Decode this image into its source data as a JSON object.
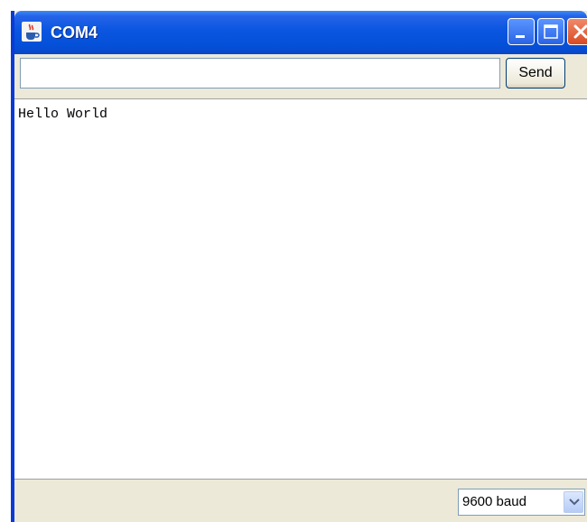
{
  "window": {
    "title": "COM4",
    "icon": "java-cup-icon",
    "controls": [
      "minimize-icon",
      "maximize-icon",
      "close-icon"
    ]
  },
  "input_bar": {
    "value": "",
    "placeholder": "",
    "send_label": "Send"
  },
  "output": {
    "text": "Hello World"
  },
  "status_bar": {
    "baud_rate": "9600 baud"
  },
  "colors": {
    "titlebar": "#0a56e0",
    "close_button": "#d84a23",
    "window_face": "#ece9d8"
  }
}
